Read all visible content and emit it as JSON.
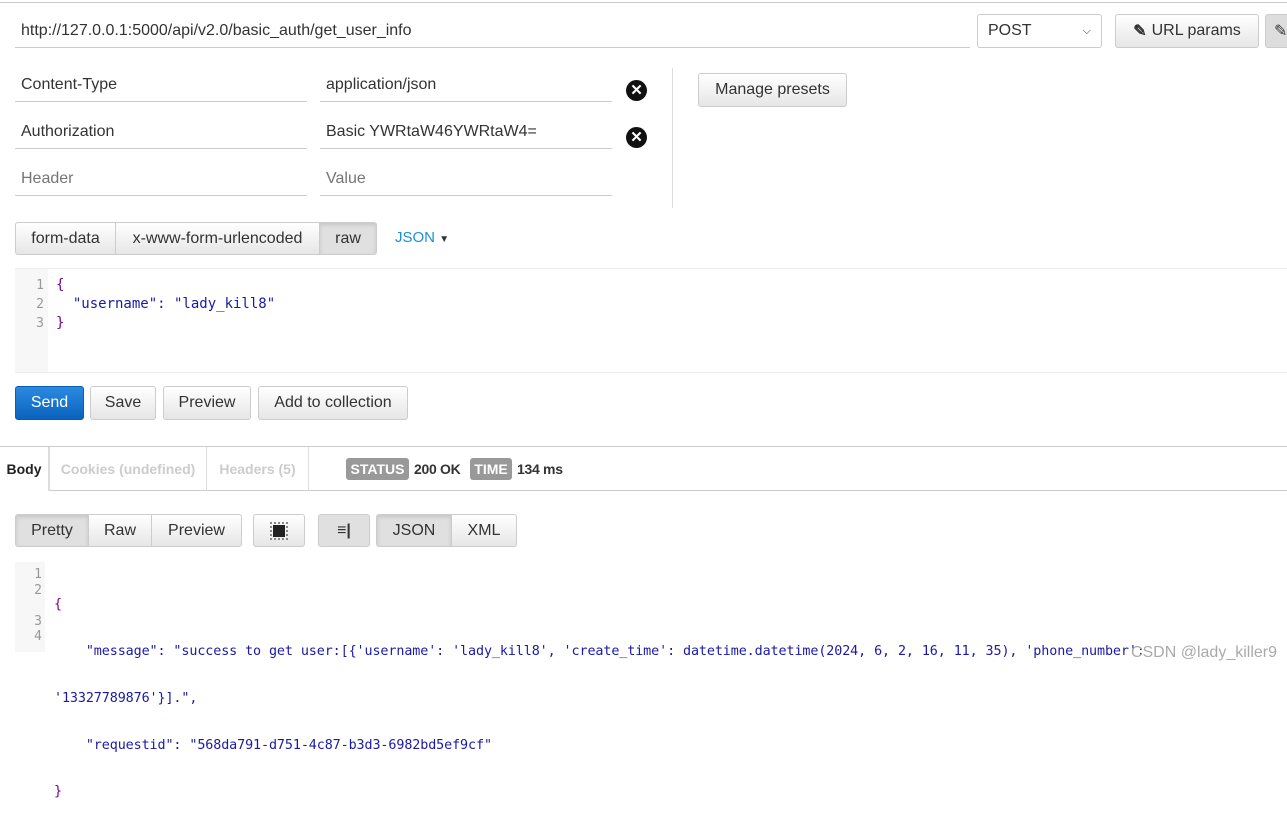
{
  "request": {
    "url": "http://127.0.0.1:5000/api/v2.0/basic_auth/get_user_info",
    "method": "POST",
    "url_params_label": "URL params",
    "headers": [
      {
        "key": "Content-Type",
        "value": "application/json"
      },
      {
        "key": "Authorization",
        "value": "Basic YWRtaW46YWRtaW4="
      }
    ],
    "header_placeholder": "Header",
    "value_placeholder": "Value",
    "manage_presets_label": "Manage presets",
    "body_modes": [
      "form-data",
      "x-www-form-urlencoded",
      "raw"
    ],
    "active_body_mode": "raw",
    "raw_type": "JSON",
    "body_lines": [
      "{",
      "  \"username\": \"lady_kill8\"",
      "}"
    ],
    "actions": {
      "send": "Send",
      "save": "Save",
      "preview": "Preview",
      "add": "Add to collection"
    }
  },
  "response": {
    "tabs": [
      "Body",
      "Cookies (undefined)",
      "Headers (5)"
    ],
    "status_label": "STATUS",
    "status": "200 OK",
    "time_label": "TIME",
    "time": "134 ms",
    "view_modes": [
      "Pretty",
      "Raw",
      "Preview"
    ],
    "formats": [
      "JSON",
      "XML"
    ],
    "line_numbers": [
      "1",
      "2",
      "",
      "3",
      "4"
    ],
    "lines": [
      "{",
      "    \"message\": \"success to get user:[{'username': 'lady_kill8', 'create_time': datetime.datetime(2024, 6, 2, 16, 11, 35), 'phone_number':",
      "'13327789876'}].\",",
      "    \"requestid\": \"568da791-d751-4c87-b3d3-6982bd5ef9cf\"",
      "}"
    ]
  },
  "watermark": "CSDN @lady_killer9",
  "colors": {
    "accent": "#0a72d0",
    "link": "#1a8fd6",
    "badge": "#999999"
  }
}
